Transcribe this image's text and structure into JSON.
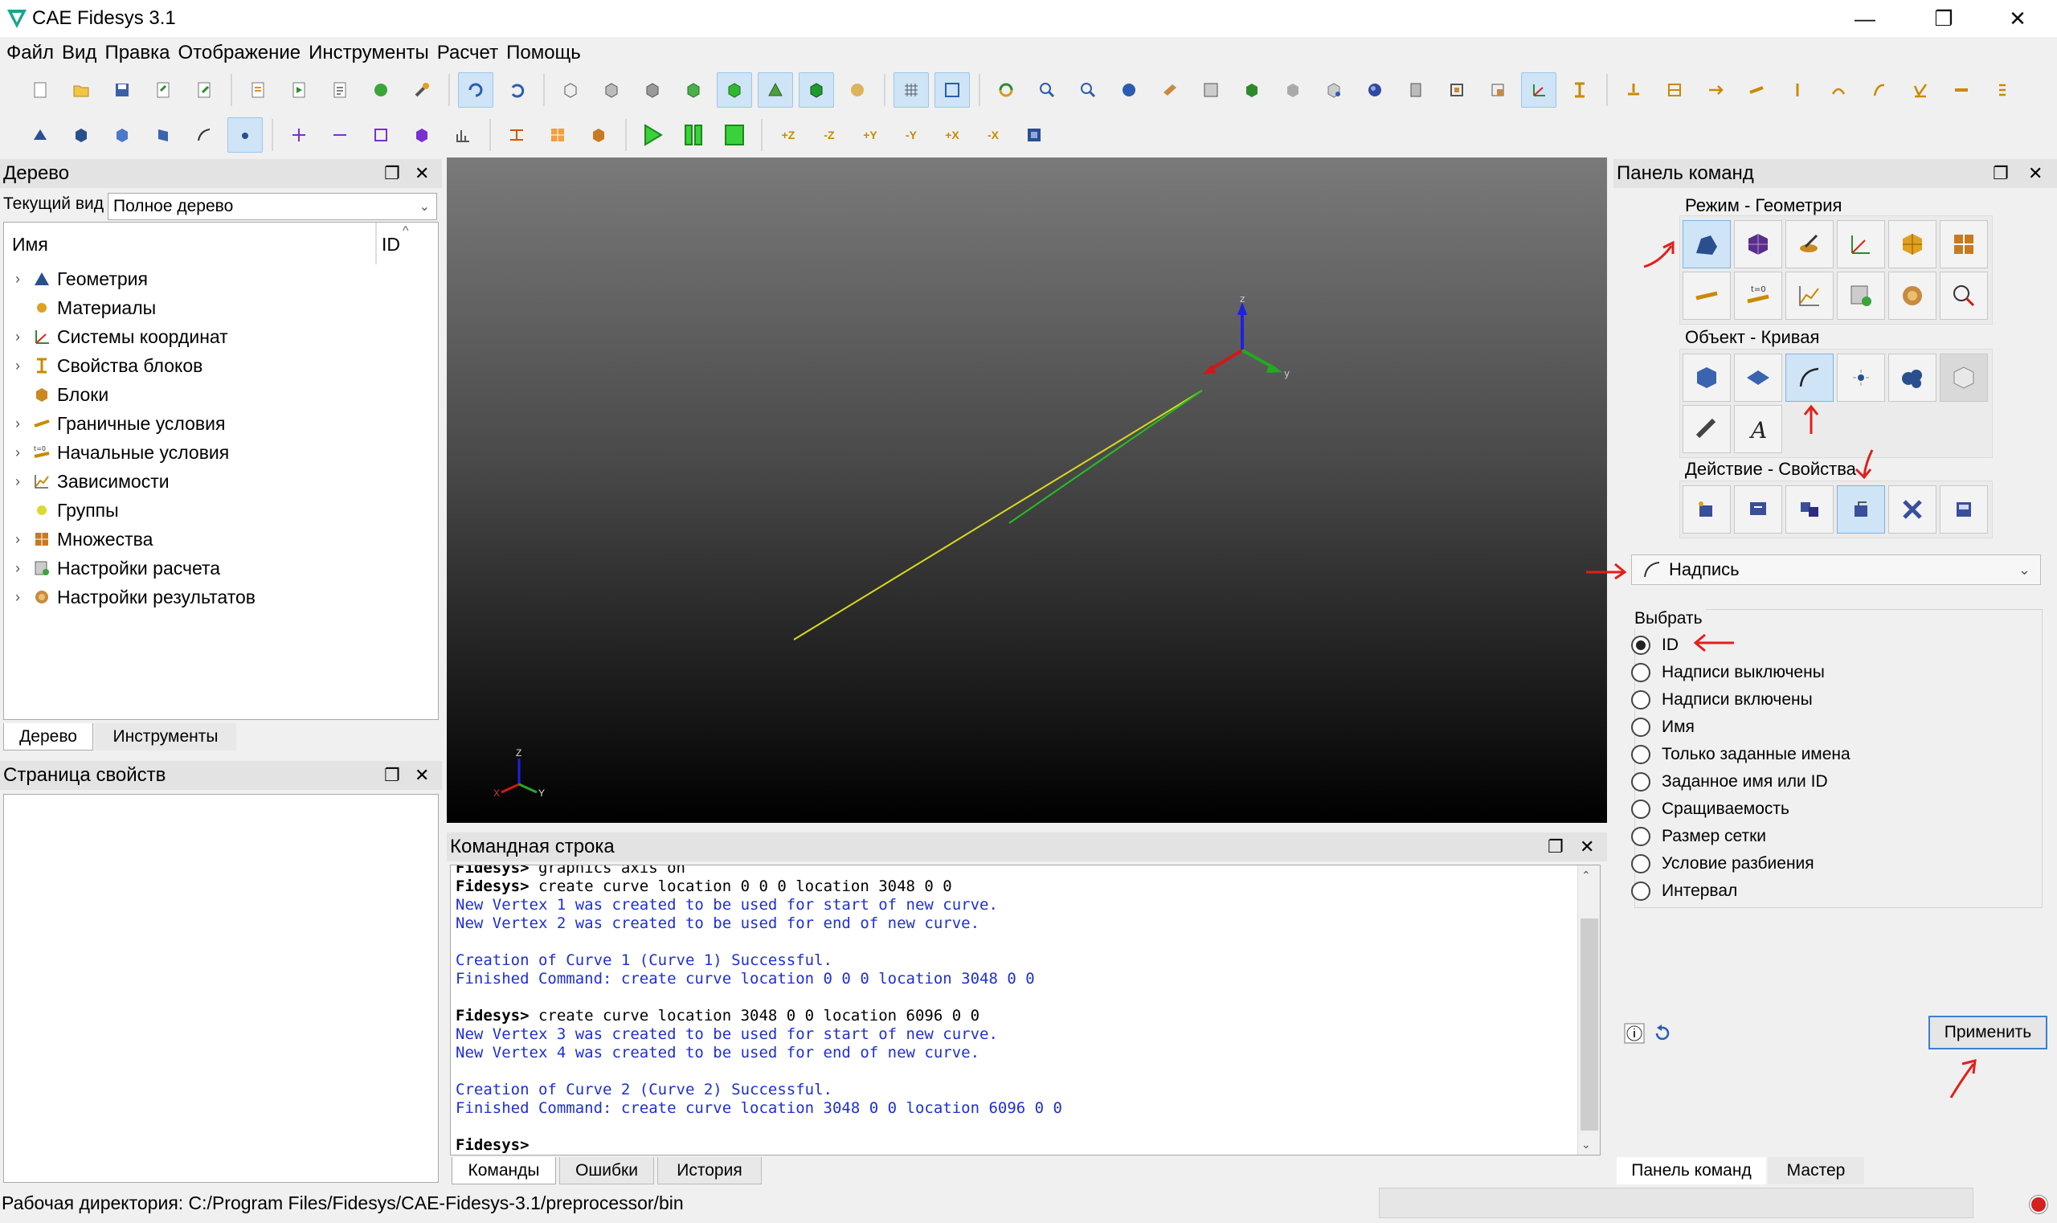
{
  "window": {
    "title": "CAE Fidesys 3.1",
    "minimize": "—",
    "maximize": "❐",
    "close": "✕"
  },
  "menu": [
    "Файл",
    "Вид",
    "Правка",
    "Отображение",
    "Инструменты",
    "Расчет",
    "Помощь"
  ],
  "tree_panel": {
    "title": "Дерево",
    "view_label": "Текущий вид",
    "view_value": "Полное дерево",
    "col_name": "Имя",
    "col_id": "ID",
    "items": [
      {
        "label": "Геометрия",
        "expandable": true
      },
      {
        "label": "Материалы",
        "expandable": false
      },
      {
        "label": "Системы координат",
        "expandable": true
      },
      {
        "label": "Свойства блоков",
        "expandable": true
      },
      {
        "label": "Блоки",
        "expandable": false
      },
      {
        "label": "Граничные условия",
        "expandable": true
      },
      {
        "label": "Начальные условия",
        "expandable": true
      },
      {
        "label": "Зависимости",
        "expandable": true
      },
      {
        "label": "Группы",
        "expandable": false
      },
      {
        "label": "Множества",
        "expandable": true
      },
      {
        "label": "Настройки расчета",
        "expandable": true
      },
      {
        "label": "Настройки результатов",
        "expandable": true
      }
    ],
    "tabs": [
      "Дерево",
      "Инструменты"
    ]
  },
  "properties_panel": {
    "title": "Страница свойств"
  },
  "viewport": {
    "triad_z": "Z",
    "triad_y": "Y",
    "triad_x": "X"
  },
  "console": {
    "title": "Командная строка",
    "lines": [
      {
        "type": "cmd",
        "prompt": "Fidesys>",
        "text": " graphics axis on"
      },
      {
        "type": "cmd",
        "prompt": "Fidesys>",
        "text": " create curve location 0 0 0 location 3048 0 0"
      },
      {
        "type": "out",
        "text": "New Vertex 1 was created to be used for start of new curve."
      },
      {
        "type": "out",
        "text": "New Vertex 2 was created to be used for end of new curve."
      },
      {
        "type": "out",
        "text": ""
      },
      {
        "type": "out",
        "text": "Creation of Curve 1 (Curve 1) Successful."
      },
      {
        "type": "out",
        "text": "Finished Command: create curve location 0 0 0 location 3048 0 0"
      },
      {
        "type": "out",
        "text": ""
      },
      {
        "type": "cmd",
        "prompt": "Fidesys>",
        "text": " create curve location 3048 0 0 location 6096 0 0"
      },
      {
        "type": "out",
        "text": "New Vertex 3 was created to be used for start of new curve."
      },
      {
        "type": "out",
        "text": "New Vertex 4 was created to be used for end of new curve."
      },
      {
        "type": "out",
        "text": ""
      },
      {
        "type": "out",
        "text": "Creation of Curve 2 (Curve 2) Successful."
      },
      {
        "type": "out",
        "text": "Finished Command: create curve location 3048 0 0 location 6096 0 0"
      },
      {
        "type": "out",
        "text": ""
      },
      {
        "type": "cmd",
        "prompt": "Fidesys>",
        "text": ""
      }
    ],
    "tabs": [
      "Команды",
      "Ошибки",
      "История"
    ]
  },
  "command_panel": {
    "title": "Панель команд",
    "mode_label": "Режим - Геометрия",
    "object_label": "Объект - Кривая",
    "action_label": "Действие - Свойства",
    "dropdown_value": "Надпись",
    "select_label": "Выбрать",
    "options": [
      {
        "label": "ID",
        "selected": true
      },
      {
        "label": "Надписи выключены",
        "selected": false
      },
      {
        "label": "Надписи включены",
        "selected": false
      },
      {
        "label": "Имя",
        "selected": false
      },
      {
        "label": "Только заданные имена",
        "selected": false
      },
      {
        "label": "Заданное имя или ID",
        "selected": false
      },
      {
        "label": "Сращиваемость",
        "selected": false
      },
      {
        "label": "Размер сетки",
        "selected": false
      },
      {
        "label": "Условие разбиения",
        "selected": false
      },
      {
        "label": "Интервал",
        "selected": false
      }
    ],
    "apply": "Применить",
    "tabs": [
      "Панель команд",
      "Мастер"
    ]
  },
  "status": {
    "workdir": "Рабочая директория: C:/Program Files/Fidesys/CAE-Fidesys-3.1/preprocessor/bin"
  },
  "colors": {
    "accent": "#cfe4f7",
    "annotation": "#e0201b",
    "console_output": "#1e2fd6"
  }
}
